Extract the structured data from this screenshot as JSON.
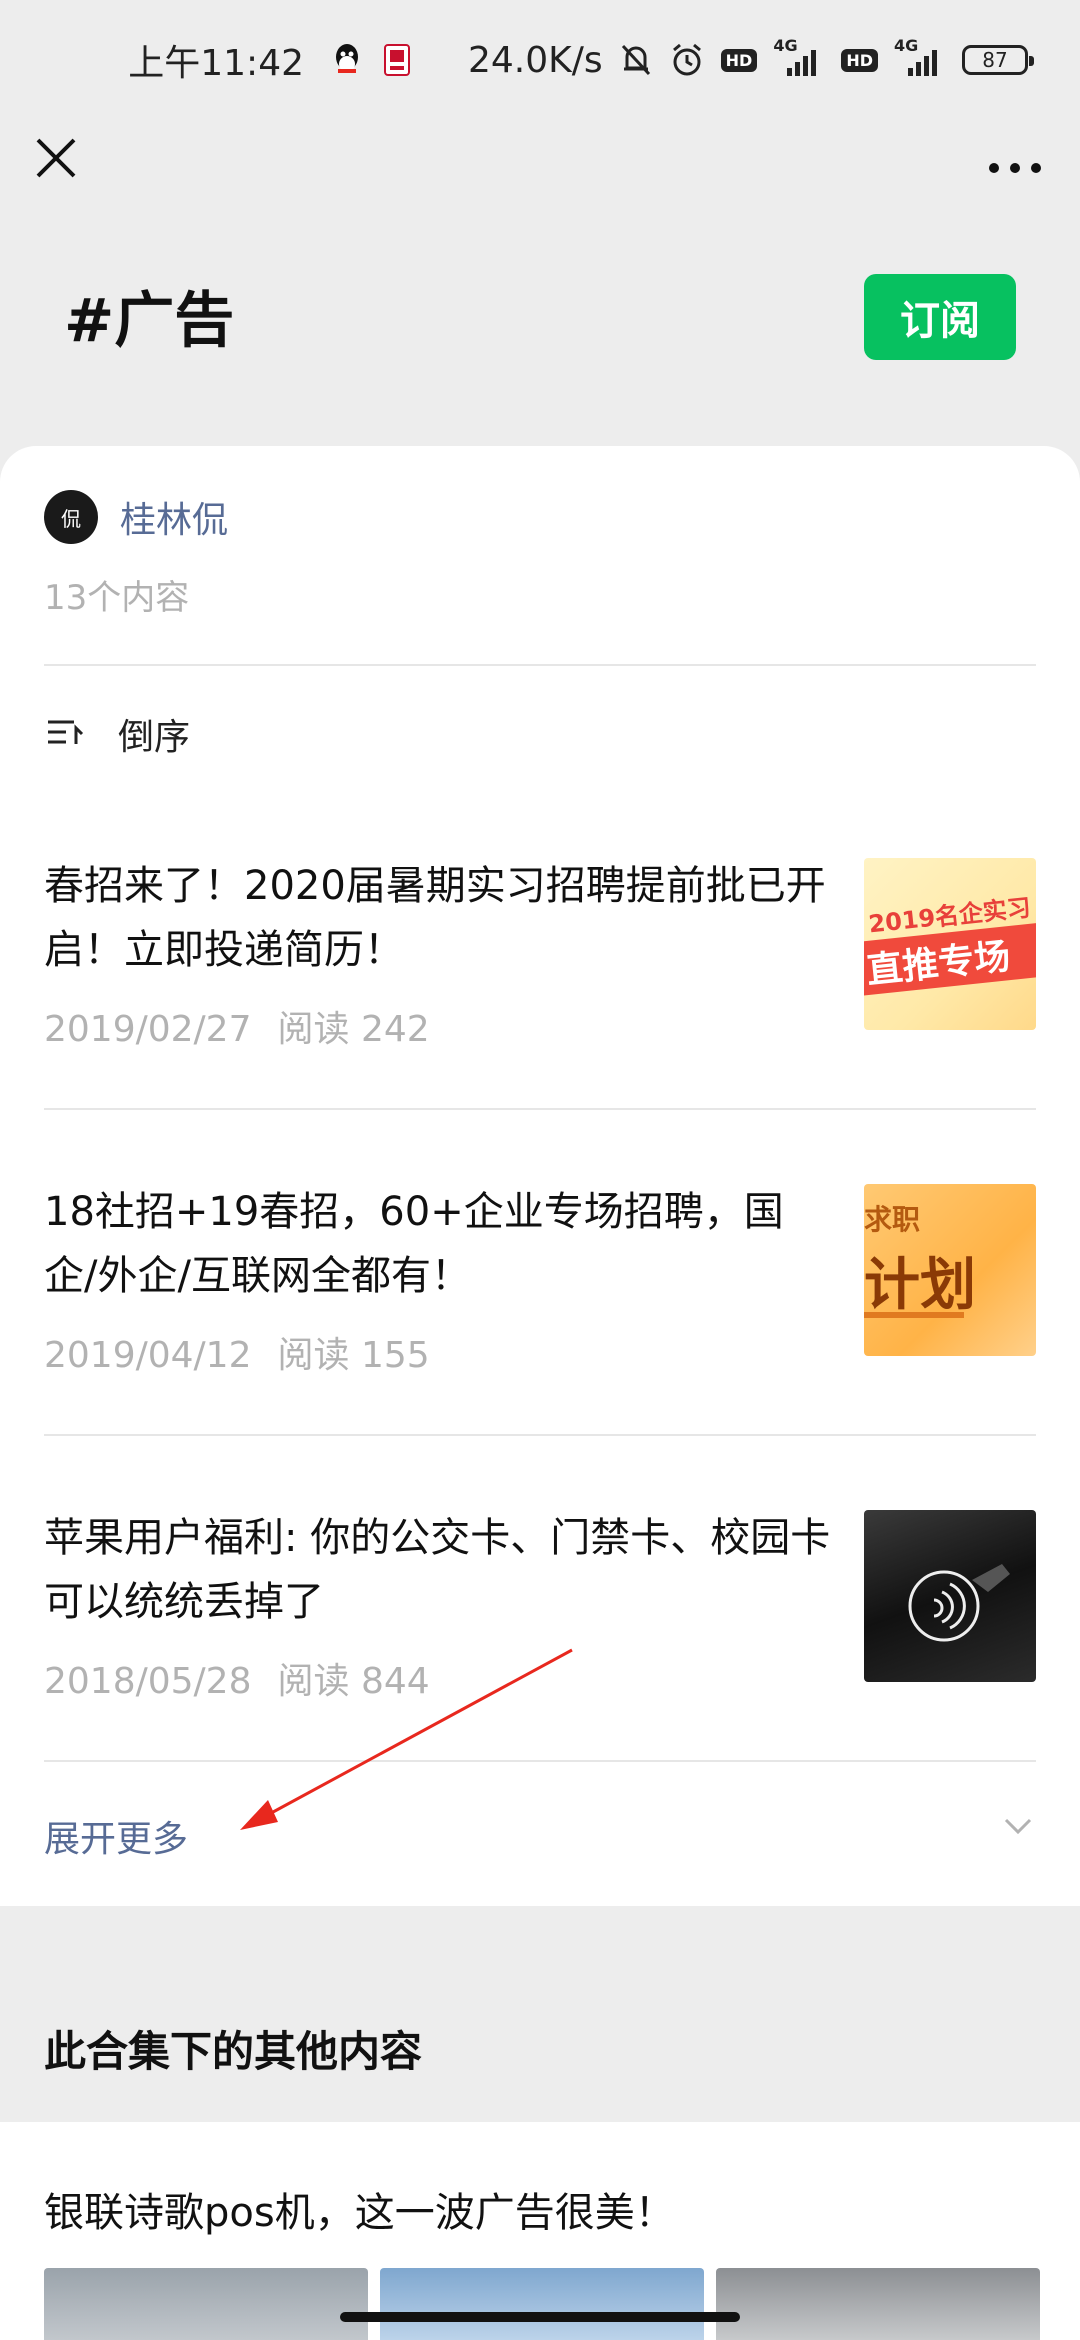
{
  "status_bar": {
    "time": "上午11:42",
    "network_speed": "24.0K/s",
    "signal_label_1": "4G",
    "signal_label_2": "4G",
    "hd_label": "HD",
    "battery": "87"
  },
  "header": {
    "title": "#广告",
    "subscribe_label": "订阅"
  },
  "collection": {
    "author": "桂林侃",
    "avatar_text": "侃",
    "count_text": "13个内容",
    "sort_label": "倒序",
    "articles": [
      {
        "title": "春招来了！2020届暑期实习招聘提前批已开启！立即投递简历！",
        "date": "2019/02/27",
        "reads": "阅读 242",
        "thumb_text_top": "2019名企实习",
        "thumb_text_band": "直推专场"
      },
      {
        "title": "18社招+19春招，60+企业专场招聘，国企/外企/互联网全都有！",
        "date": "2019/04/12",
        "reads": "阅读 155",
        "thumb_text_top": "求职",
        "thumb_text_band": "计划"
      },
      {
        "title": "苹果用户福利: 你的公交卡、门禁卡、校园卡可以统统丢掉了",
        "date": "2018/05/28",
        "reads": "阅读 844"
      }
    ],
    "expand_label": "展开更多"
  },
  "other": {
    "section_title": "此合集下的其他内容",
    "item_title": "银联诗歌pos机，这一波广告很美！"
  },
  "colors": {
    "accent_green": "#07c160",
    "link_blue": "#576b95",
    "annotation_red": "#e8281e"
  }
}
